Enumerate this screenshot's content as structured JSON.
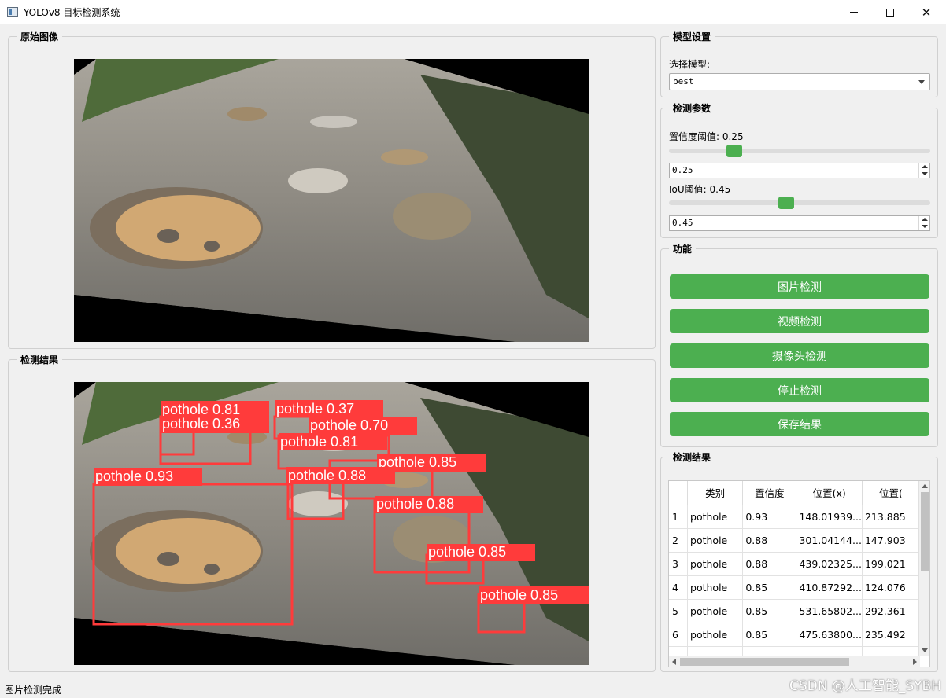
{
  "window": {
    "title": "YOLOv8 目标检测系统",
    "controls": [
      "minimize",
      "maximize",
      "close"
    ]
  },
  "panels": {
    "original_title": "原始图像",
    "result_title": "检测结果"
  },
  "detections_overlay": [
    {
      "label": "pothole 0.81"
    },
    {
      "label": "pothole 0.37"
    },
    {
      "label": "pothole 0.36"
    },
    {
      "label": "pothole 0.70"
    },
    {
      "label": "pothole 0.81"
    },
    {
      "label": "pothole 0.85"
    },
    {
      "label": "pothole 0.93"
    },
    {
      "label": "pothole 0.88"
    },
    {
      "label": "pothole 0.88"
    },
    {
      "label": "pothole 0.85"
    },
    {
      "label": "pothole 0.85"
    }
  ],
  "model": {
    "title": "模型设置",
    "label": "选择模型:",
    "selected": "best"
  },
  "params": {
    "title": "检测参数",
    "conf_label": "置信度阈值: 0.25",
    "conf_value": "0.25",
    "conf_level": 0.25,
    "iou_label": "IoU阈值: 0.45",
    "iou_value": "0.45",
    "iou_level": 0.45
  },
  "functions": {
    "title": "功能",
    "image_detect": "图片检测",
    "video_detect": "视频检测",
    "camera_detect": "摄像头检测",
    "stop_detect": "停止检测",
    "save_results": "保存结果"
  },
  "results_table": {
    "title": "检测结果",
    "headers": [
      "类别",
      "置信度",
      "位置(x)",
      "位置("
    ],
    "rows": [
      {
        "num": "1",
        "class": "pothole",
        "conf": "0.93",
        "x": "148.01939...",
        "y": "213.885"
      },
      {
        "num": "2",
        "class": "pothole",
        "conf": "0.88",
        "x": "301.04144...",
        "y": "147.903"
      },
      {
        "num": "3",
        "class": "pothole",
        "conf": "0.88",
        "x": "439.02325...",
        "y": "199.021"
      },
      {
        "num": "4",
        "class": "pothole",
        "conf": "0.85",
        "x": "410.87292...",
        "y": "124.076"
      },
      {
        "num": "5",
        "class": "pothole",
        "conf": "0.85",
        "x": "531.65802...",
        "y": "292.361"
      },
      {
        "num": "6",
        "class": "pothole",
        "conf": "0.85",
        "x": "475.63800...",
        "y": "235.492"
      },
      {
        "num": "",
        "class": "",
        "conf": "",
        "x": "",
        "y": ""
      }
    ]
  },
  "status": "图片检测完成",
  "watermark": "CSDN @人工智能_SYBH",
  "colors": {
    "accent_green": "#4caf50",
    "box_red": "#ff3b3b"
  }
}
